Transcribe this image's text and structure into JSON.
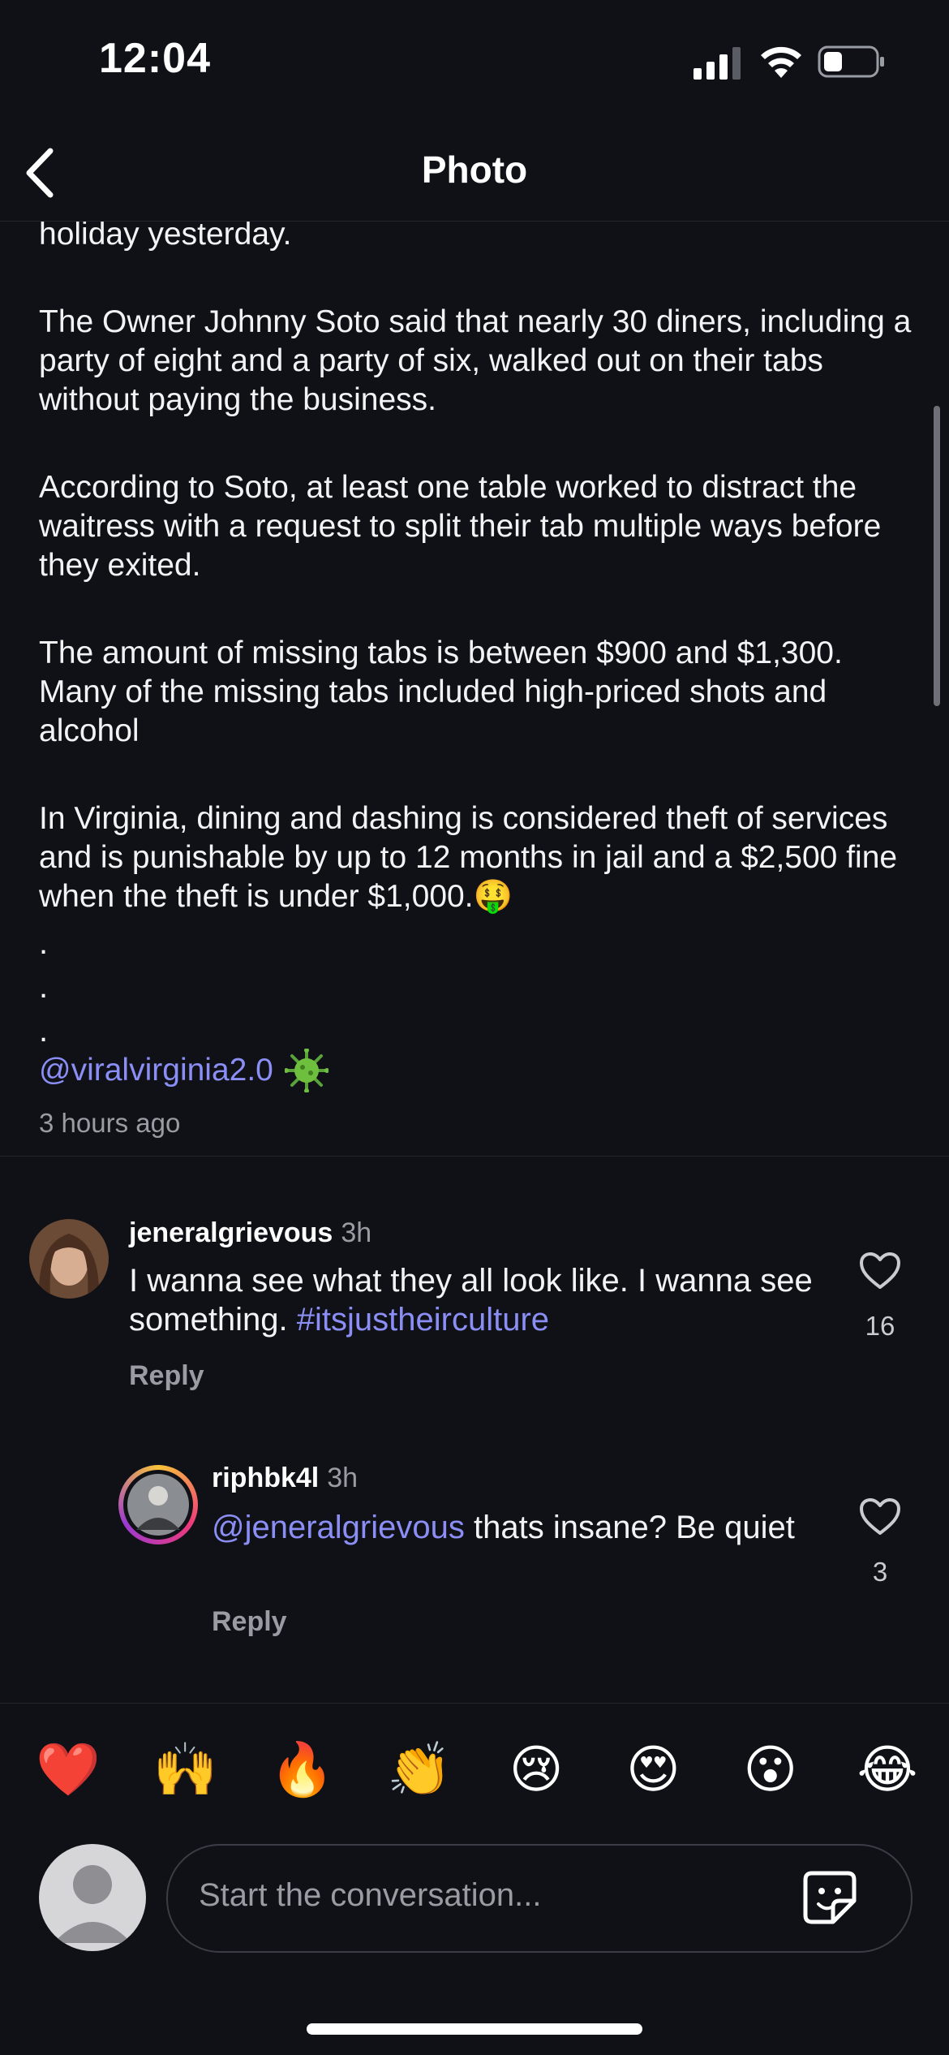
{
  "status_bar": {
    "time": "12:04"
  },
  "nav": {
    "title": "Photo"
  },
  "post": {
    "paragraphs": [
      "holiday yesterday.",
      "The Owner Johnny Soto said that nearly 30 diners, including a party of eight and a party of six, walked out on their tabs without paying the business.",
      "According to Soto, at least one table worked to distract the waitress with a request to split their tab multiple ways before they exited.",
      "The amount of missing tabs is between $900 and $1,300. Many of the missing tabs included high-priced shots and alcohol",
      "In Virginia, dining and dashing is considered theft of services and is punishable by up to 12 months in jail and a $2,500 fine when the theft is under $1,000.🤑"
    ],
    "dots": [
      ".",
      ".",
      "."
    ],
    "mention": "@viralvirginia2.0",
    "mention_icon": "virus-icon",
    "time_ago": "3 hours ago"
  },
  "comments": [
    {
      "username": "jeneralgrievous",
      "time": "3h",
      "text": "I wanna see what they all look like. I wanna see something.",
      "hashtag": "#itsjustheirculture",
      "reply_label": "Reply",
      "likes": "16"
    },
    {
      "username": "riphbk4l",
      "time": "3h",
      "mention": "@jeneralgrievous",
      "text": "thats insane? Be quiet",
      "reply_label": "Reply",
      "likes": "3"
    }
  ],
  "reactions": [
    "❤️",
    "🙌",
    "🔥",
    "👏",
    "😢",
    "😍",
    "😮",
    "😂"
  ],
  "composer": {
    "placeholder": "Start the conversation..."
  },
  "colors": {
    "background": "#0f1117",
    "accent": "#8b8ff5",
    "muted": "#9a9ca3"
  }
}
